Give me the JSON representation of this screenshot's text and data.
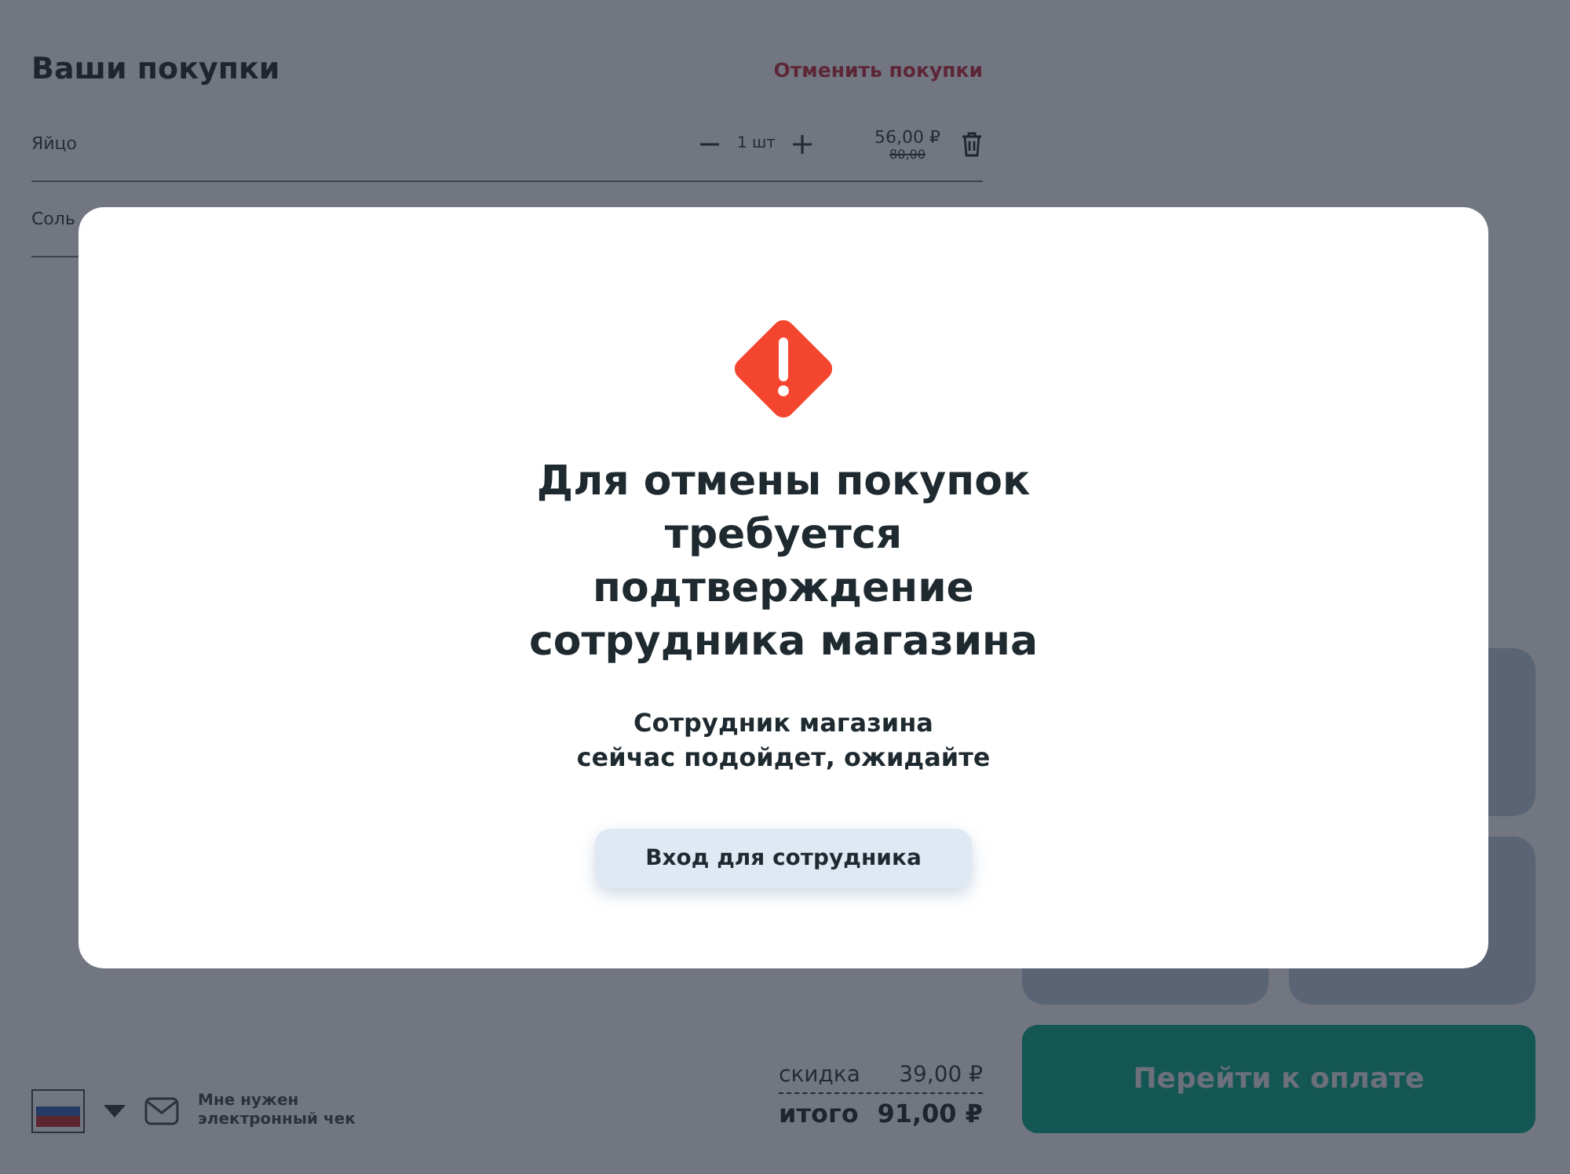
{
  "cart": {
    "title": "Ваши покупки",
    "cancel_link": "Отменить покупки",
    "items": [
      {
        "name": "Яйцо",
        "quantity": "1 шт",
        "price": "56,00 ₽",
        "old_price": "80,00"
      },
      {
        "name": "Соль"
      }
    ]
  },
  "summary": {
    "discount_label": "скидка",
    "discount": "39,00 ₽",
    "total_label": "итого",
    "total": "91,00 ₽"
  },
  "receipt": {
    "label_lines": [
      "Мне нужен",
      "электронный чек"
    ]
  },
  "pay_button": "Перейти к оплате",
  "dialog": {
    "title_lines": [
      "Для отмены покупок",
      "требуется",
      "подтверждение",
      "сотрудника магазина"
    ],
    "message_lines": [
      "Сотрудник магазина",
      "сейчас подойдет, ожидайте"
    ],
    "button": "Вход для сотрудника"
  }
}
